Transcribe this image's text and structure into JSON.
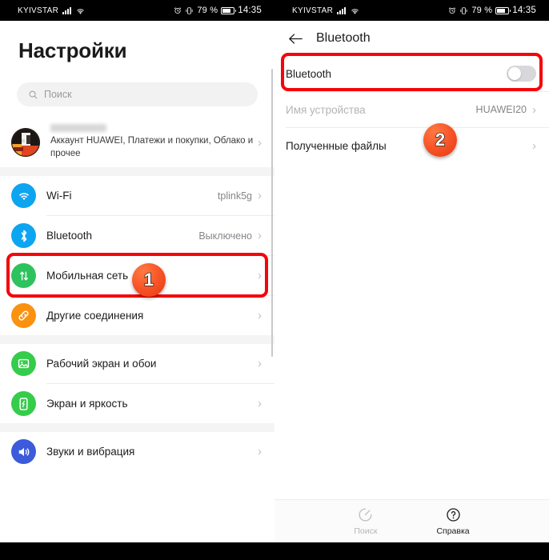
{
  "statusbar": {
    "carrier": "KYIVSTAR",
    "battery_percent": "79 %",
    "time": "14:35",
    "icons": [
      "signal-bars-icon",
      "wifi-icon",
      "alarm-icon",
      "vibrate-icon",
      "battery-icon"
    ]
  },
  "left": {
    "title": "Настройки",
    "search_placeholder": "Поиск",
    "account": {
      "name_masked": "",
      "subtitle": "Аккаунт HUAWEI, Платежи и покупки, Облако и прочее"
    },
    "items": [
      {
        "label": "Wi-Fi",
        "value": "tplink5g",
        "icon": "wifi-icon",
        "color": "#0ea5f0"
      },
      {
        "label": "Bluetooth",
        "value": "Выключено",
        "icon": "bluetooth-icon",
        "color": "#0ea5f0"
      },
      {
        "label": "Мобильная сеть",
        "value": "",
        "icon": "mobile-network-icon",
        "color": "#2ec25e"
      },
      {
        "label": "Другие соединения",
        "value": "",
        "icon": "link-icon",
        "color": "#fb9110"
      },
      {
        "label": "Рабочий экран и обои",
        "value": "",
        "icon": "wallpaper-icon",
        "color": "#35cc4b"
      },
      {
        "label": "Экран и яркость",
        "value": "",
        "icon": "display-brightness-icon",
        "color": "#35cc4b"
      },
      {
        "label": "Звуки и вибрация",
        "value": "",
        "icon": "sound-icon",
        "color": "#3b5bdb"
      }
    ],
    "chevron": "›"
  },
  "right": {
    "appbar_title": "Bluetooth",
    "back_icon": "back-arrow-icon",
    "rows": [
      {
        "label": "Bluetooth",
        "value": "",
        "control": "toggle-off"
      },
      {
        "label": "Имя устройства",
        "value": "HUAWEI20",
        "control": "chevron"
      },
      {
        "label": "Полученные файлы",
        "value": "",
        "control": "chevron"
      }
    ],
    "chevron": "›",
    "bottombar": [
      {
        "label": "Поиск",
        "icon": "scan-icon",
        "enabled": false
      },
      {
        "label": "Справка",
        "icon": "help-icon",
        "enabled": true
      }
    ]
  },
  "annotations": {
    "badge1": "1",
    "badge2": "2",
    "highlight_color": "#f5050a"
  }
}
